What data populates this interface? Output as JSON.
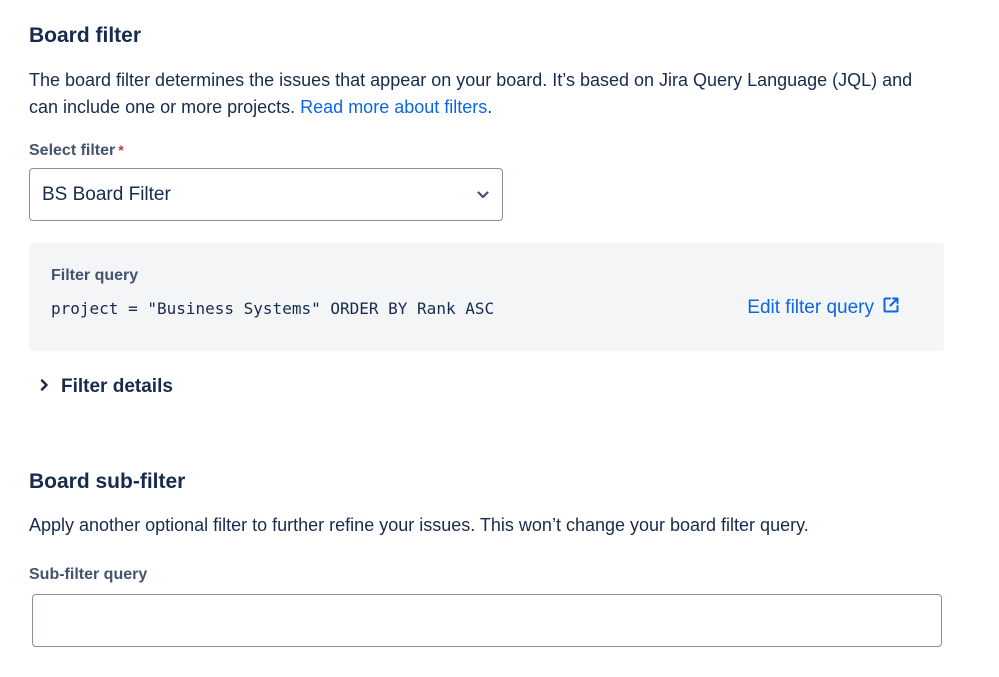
{
  "board_filter": {
    "title": "Board filter",
    "description_text": "The board filter determines the issues that appear on your board. It’s based on Jira Query Language (JQL) and can include one or more projects. ",
    "read_more_link": "Read more about filters",
    "description_end": ".",
    "select_label": "Select filter",
    "required_marker": "*",
    "selected_filter": "BS Board Filter",
    "query_label": "Filter query",
    "query": "project = \"Business Systems\" ORDER BY Rank ASC",
    "edit_link": "Edit filter query",
    "details_toggle": "Filter details"
  },
  "sub_filter": {
    "title": "Board sub-filter",
    "description": "Apply another optional filter to further refine your issues. This won’t change your board filter query.",
    "label": "Sub-filter query",
    "value": ""
  },
  "colors": {
    "link": "#0c66e4",
    "required": "#c9372c",
    "text": "#172b4d",
    "subtle_text": "#44546f",
    "panel_bg": "#f4f5f7",
    "border": "#8590a2"
  },
  "icons": {
    "select_chevron": "chevron-down-icon",
    "edit_link": "external-link-icon",
    "details_toggle": "chevron-right-icon"
  }
}
